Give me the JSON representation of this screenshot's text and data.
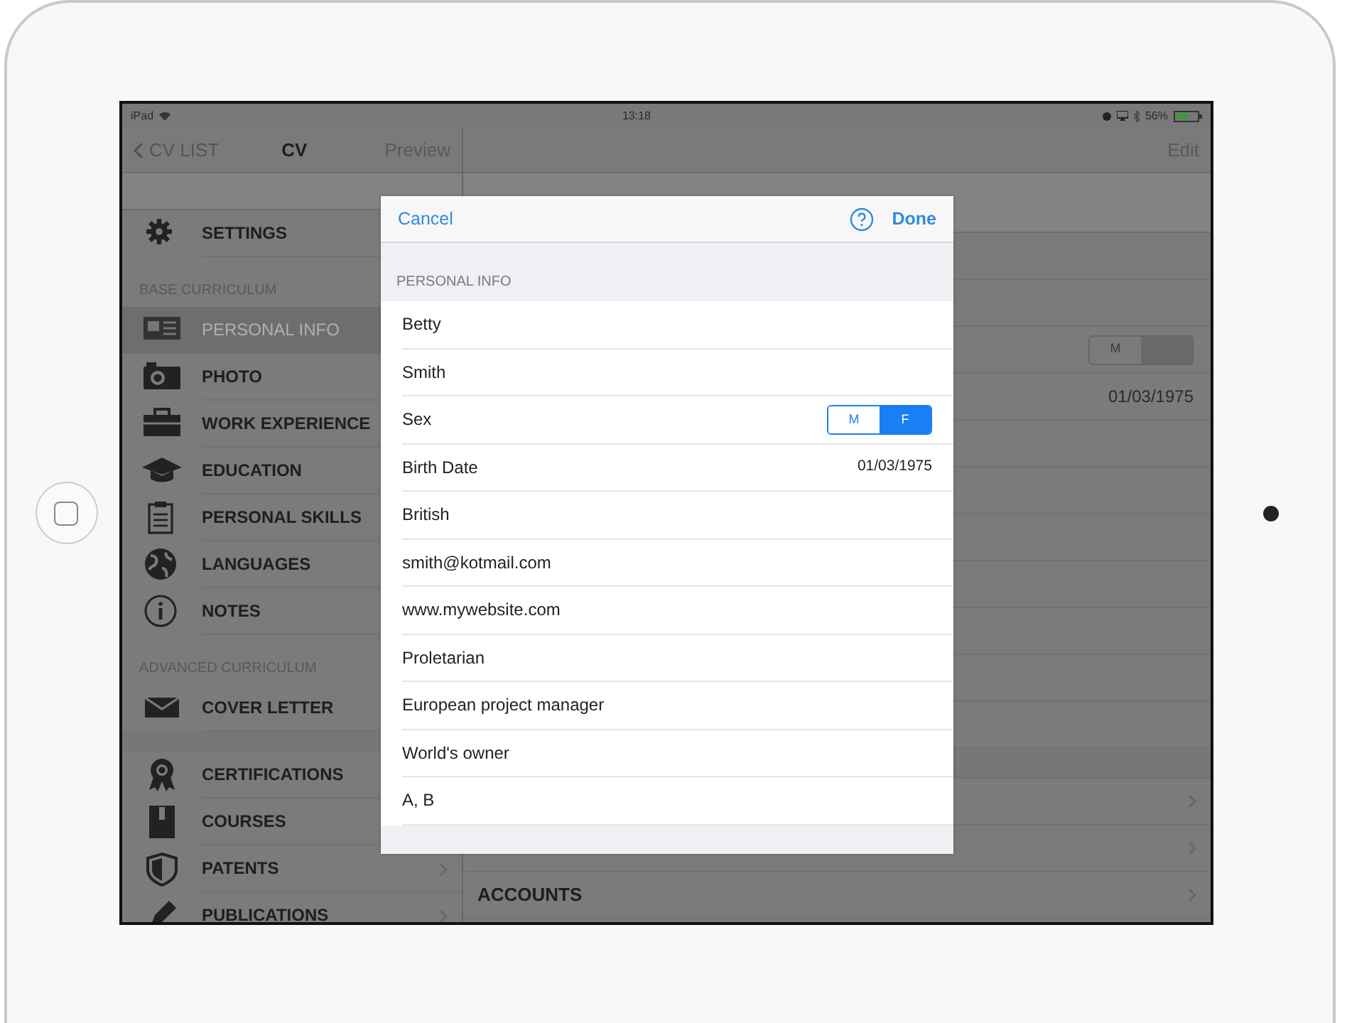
{
  "status_bar": {
    "device": "iPad",
    "time": "13:18",
    "battery": "56%"
  },
  "sidebar": {
    "back": "CV LIST",
    "title": "CV",
    "action": "Preview",
    "sections": [
      {
        "items": [
          {
            "label": "SETTINGS",
            "selected": false
          }
        ]
      },
      {
        "header": "BASE CURRICULUM",
        "items": [
          {
            "label": "PERSONAL INFO",
            "selected": true
          },
          {
            "label": "PHOTO",
            "selected": false
          },
          {
            "label": "WORK EXPERIENCE",
            "selected": false
          },
          {
            "label": "EDUCATION",
            "selected": false
          },
          {
            "label": "PERSONAL SKILLS",
            "selected": false
          },
          {
            "label": "LANGUAGES",
            "selected": false
          },
          {
            "label": "NOTES",
            "selected": false
          }
        ]
      },
      {
        "header": "ADVANCED CURRICULUM",
        "items": [
          {
            "label": "COVER LETTER",
            "selected": false
          }
        ]
      },
      {
        "items": [
          {
            "label": "CERTIFICATIONS",
            "selected": false
          },
          {
            "label": "COURSES",
            "selected": false
          },
          {
            "label": "PATENTS",
            "selected": false,
            "chevron": true
          },
          {
            "label": "PUBLICATIONS",
            "selected": false,
            "chevron": true
          }
        ]
      }
    ]
  },
  "detail": {
    "action": "Edit",
    "rows": [
      {
        "kind": "plain"
      },
      {
        "kind": "plain"
      },
      {
        "kind": "segmented",
        "options": [
          {
            "label": "M",
            "selected": false
          },
          {
            "selected": true
          }
        ]
      },
      {
        "kind": "value",
        "value": "01/03/1975"
      },
      {
        "kind": "plain"
      },
      {
        "kind": "plain"
      },
      {
        "kind": "plain"
      },
      {
        "kind": "plain"
      },
      {
        "kind": "plain"
      },
      {
        "kind": "plain"
      },
      {
        "kind": "plain"
      }
    ],
    "link_rows": [
      {
        "chevron": true
      },
      {
        "chevron": true
      },
      {
        "label": "ACCOUNTS",
        "chevron": true
      }
    ]
  },
  "modal": {
    "cancel": "Cancel",
    "done": "Done",
    "section": "PERSONAL INFO",
    "fields": [
      {
        "kind": "text",
        "value": "Betty"
      },
      {
        "kind": "text",
        "value": "Smith"
      },
      {
        "kind": "segmented",
        "label": "Sex",
        "options": [
          {
            "label": "M",
            "selected": false
          },
          {
            "label": "F",
            "selected": true
          }
        ]
      },
      {
        "kind": "date",
        "label": "Birth Date",
        "value": "01/03/1975"
      },
      {
        "kind": "text",
        "value": "British"
      },
      {
        "kind": "text",
        "value": "smith@kotmail.com"
      },
      {
        "kind": "text",
        "value": "www.mywebsite.com"
      },
      {
        "kind": "text",
        "value": "Proletarian"
      },
      {
        "kind": "text",
        "value": "European project manager"
      },
      {
        "kind": "text",
        "value": "World's owner"
      },
      {
        "kind": "text",
        "value": "A, B"
      }
    ]
  }
}
